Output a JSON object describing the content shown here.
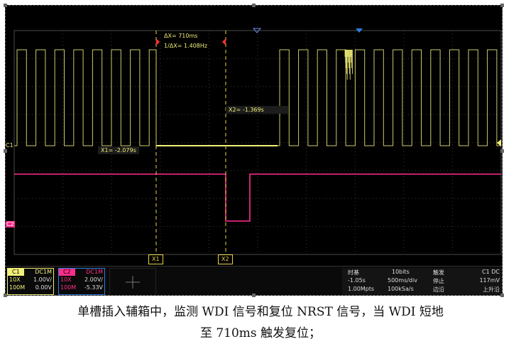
{
  "scope": {
    "delta": {
      "dx": "ΔX= 710ms",
      "inv": "1/ΔX= 1.408Hz"
    },
    "cursors": {
      "x1_label": "X1= -2.079s",
      "x2_label": "X2= -1.369s",
      "x1_tag": "X1",
      "x2_tag": "X2"
    },
    "ch1_marker": "C1",
    "ch2_marker": "C2",
    "colors": {
      "ch1": "#f2ef7a",
      "ch2": "#ff2d8a",
      "cursor": "#e8d24a",
      "trigger": "#2f7de0"
    },
    "ch1": {
      "name": "C1",
      "coupling": "DC1M",
      "probe": "10X",
      "scale": "1.00V/",
      "impedance": "100M",
      "offset": "0.00V"
    },
    "ch2": {
      "name": "C2",
      "coupling": "DC1M",
      "probe": "10X",
      "scale": "2.00V/",
      "impedance": "100M",
      "offset": "-5.33V"
    },
    "timebase": {
      "label": "时基",
      "bits": "10bits",
      "delay": "-1.05s",
      "scale": "500ms/div",
      "points": "1.00Mpts",
      "rate": "100kSa/s"
    },
    "trigger": {
      "label": "触发",
      "source": "C1 DC",
      "state": "停止",
      "level": "117mV",
      "type": "边沿",
      "slope": "上升沿"
    }
  },
  "caption": {
    "line1": "单槽插入辅箱中，监测 WDI 信号和复位 NRST 信号，当 WDI 短地",
    "line2": "至 710ms 触发复位；"
  }
}
